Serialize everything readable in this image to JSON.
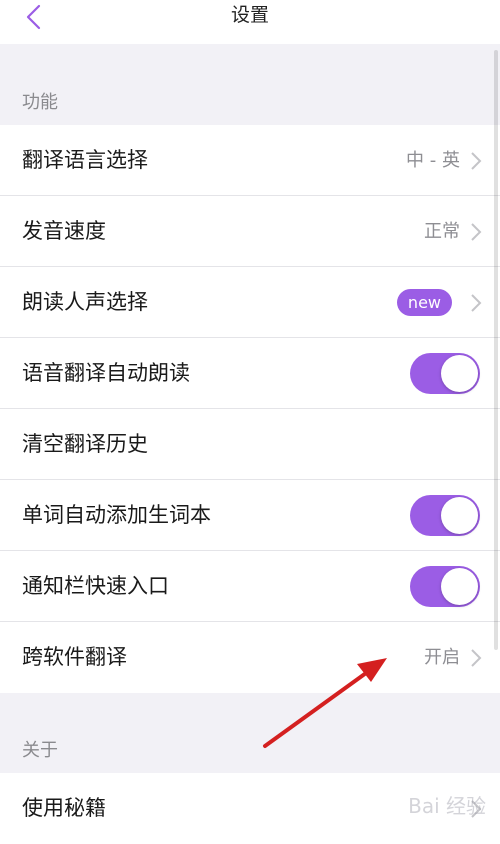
{
  "nav": {
    "title": "设置"
  },
  "sections": [
    {
      "label": "功能",
      "items": [
        {
          "label": "翻译语言选择",
          "value": "中 - 英",
          "control": "chevron"
        },
        {
          "label": "发音速度",
          "value": "正常",
          "control": "chevron"
        },
        {
          "label": "朗读人声选择",
          "badge": "new",
          "control": "chevron"
        },
        {
          "label": "语音翻译自动朗读",
          "control": "toggle",
          "on": true
        },
        {
          "label": "清空翻译历史",
          "control": "none"
        },
        {
          "label": "单词自动添加生词本",
          "control": "toggle",
          "on": true
        },
        {
          "label": "通知栏快速入口",
          "control": "toggle",
          "on": true
        },
        {
          "label": "跨软件翻译",
          "value": "开启",
          "control": "chevron"
        }
      ]
    },
    {
      "label": "关于",
      "items": [
        {
          "label": "使用秘籍",
          "control": "chevron"
        }
      ]
    }
  ],
  "watermark": "Bai 经验",
  "colors": {
    "accent": "#9b5de5",
    "background": "#f2f1f6",
    "annotation_arrow": "#d42020"
  }
}
